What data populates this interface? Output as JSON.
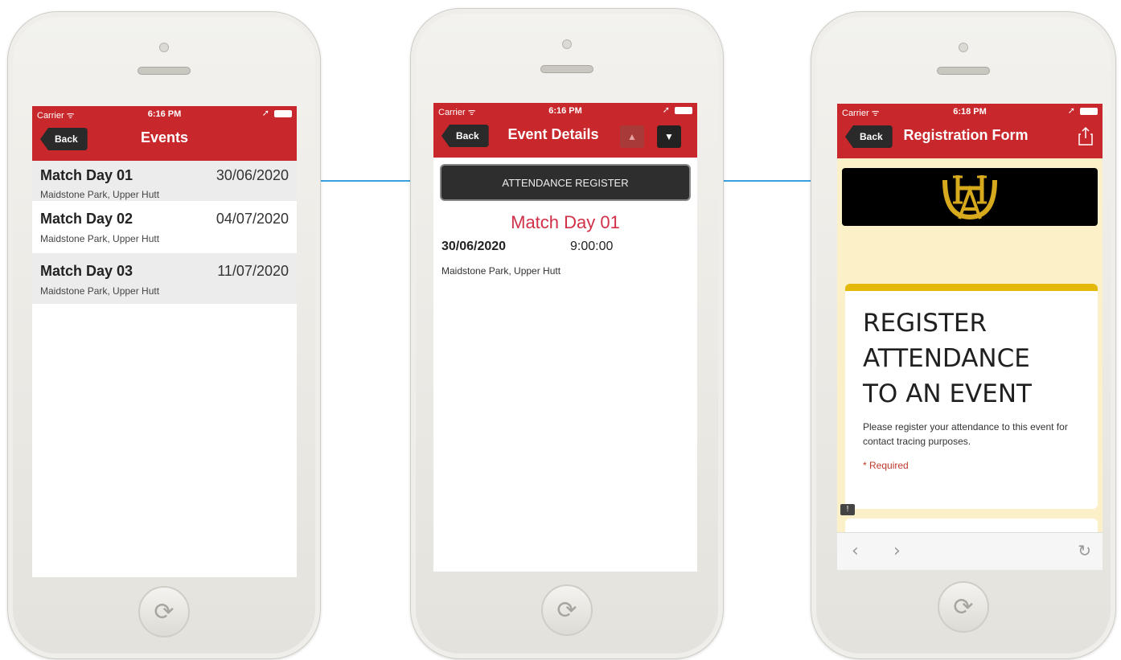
{
  "colors": {
    "navbar": "#c8272b",
    "accent_arrow": "#3aa0de",
    "title_red": "#d03048",
    "required_red": "#c0392b",
    "form_bg": "#fbf0c8",
    "card_accent": "#e4b809"
  },
  "phone1": {
    "status": {
      "carrier": "Carrier ᯤ",
      "time": "6:16 PM",
      "location_icon": "location-arrow-icon",
      "battery_icon": "battery-icon"
    },
    "back_label": "Back",
    "title": "Events",
    "events": [
      {
        "title": "Match Day 01",
        "date": "30/06/2020",
        "location": "Maidstone Park, Upper Hutt"
      },
      {
        "title": "Match Day 02",
        "date": "04/07/2020",
        "location": "Maidstone Park, Upper Hutt"
      },
      {
        "title": "Match Day 03",
        "date": "11/07/2020",
        "location": "Maidstone Park, Upper Hutt"
      }
    ]
  },
  "phone2": {
    "status": {
      "carrier": "Carrier ᯤ",
      "time": "6:16 PM"
    },
    "back_label": "Back",
    "title": "Event Details",
    "up_icon": "▲",
    "down_icon": "▼",
    "attendance_button": "ATTENDANCE REGISTER",
    "event_title": "Match Day 01",
    "event_date": "30/06/2020",
    "event_time": "9:00:00",
    "event_location": "Maidstone Park, Upper Hutt"
  },
  "phone3": {
    "status": {
      "carrier": "Carrier ᯤ",
      "time": "6:18 PM"
    },
    "back_label": "Back",
    "title": "Registration Form",
    "share_icon": "share-icon",
    "form_title_line1": "REGISTER",
    "form_title_line2": "ATTENDANCE",
    "form_title_line3": "TO AN EVENT",
    "form_description": "Please register your attendance to this event for contact tracing purposes.",
    "required_note": "* Required",
    "browser_back": "‹",
    "browser_forward": "›",
    "browser_reload": "↻"
  }
}
